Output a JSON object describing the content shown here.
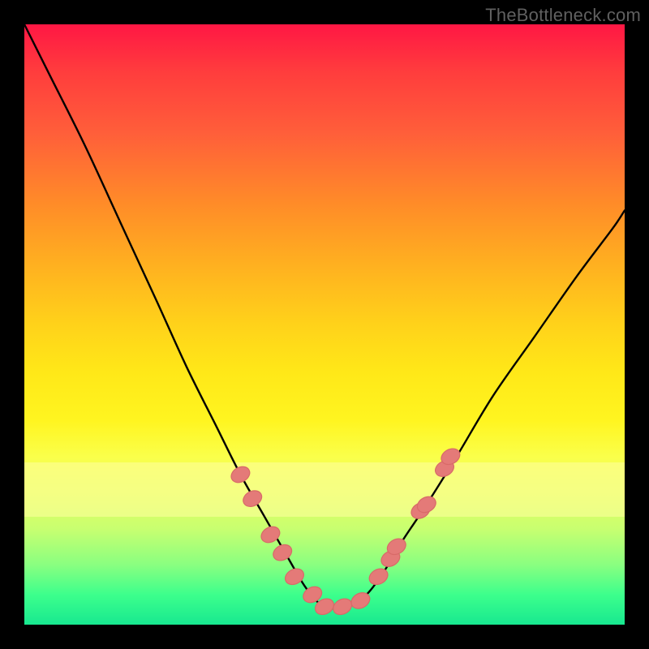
{
  "watermark": "TheBottleneck.com",
  "colors": {
    "frame": "#000000",
    "gradient_top": "#ff1744",
    "gradient_bottom": "#18e890",
    "curve": "#000000",
    "marker_fill": "#e47a78"
  },
  "chart_data": {
    "type": "line",
    "title": "",
    "xlabel": "",
    "ylabel": "",
    "xlim": [
      0,
      100
    ],
    "ylim": [
      0,
      100
    ],
    "grid": false,
    "legend": false,
    "note": "No visible axis ticks or labels. Values estimated from pixel positions on a 0–100 scale. y=100 is top of plot, y=0 is bottom. Curve is a V-shaped bottleneck plot descending from top-left to a floor near the bottom around x≈48–56, then rising to mid-right.",
    "series": [
      {
        "name": "bottleneck-curve",
        "x": [
          0,
          4,
          10,
          16,
          22,
          27,
          32,
          36,
          40,
          44,
          47,
          50,
          54,
          57,
          60,
          63,
          67,
          72,
          78,
          85,
          92,
          98,
          100
        ],
        "y": [
          100,
          92,
          80,
          67,
          54,
          43,
          33,
          25,
          18,
          11,
          6,
          3,
          3,
          5,
          9,
          14,
          20,
          28,
          38,
          48,
          58,
          66,
          69
        ]
      }
    ],
    "markers": {
      "name": "highlighted-points",
      "note": "Salmon elliptical markers clustered on both arms of the V near the bottom, roughly y between 3 and 30.",
      "points": [
        {
          "x": 36,
          "y": 25
        },
        {
          "x": 38,
          "y": 21
        },
        {
          "x": 41,
          "y": 15
        },
        {
          "x": 43,
          "y": 12
        },
        {
          "x": 45,
          "y": 8
        },
        {
          "x": 48,
          "y": 5
        },
        {
          "x": 50,
          "y": 3
        },
        {
          "x": 53,
          "y": 3
        },
        {
          "x": 56,
          "y": 4
        },
        {
          "x": 59,
          "y": 8
        },
        {
          "x": 61,
          "y": 11
        },
        {
          "x": 62,
          "y": 13
        },
        {
          "x": 66,
          "y": 19
        },
        {
          "x": 67,
          "y": 20
        },
        {
          "x": 70,
          "y": 26
        },
        {
          "x": 71,
          "y": 28
        }
      ]
    },
    "bands": [
      {
        "name": "pale-yellow-band",
        "y_from": 18,
        "y_to": 27,
        "note": "Light horizontal band across plot area"
      }
    ]
  }
}
